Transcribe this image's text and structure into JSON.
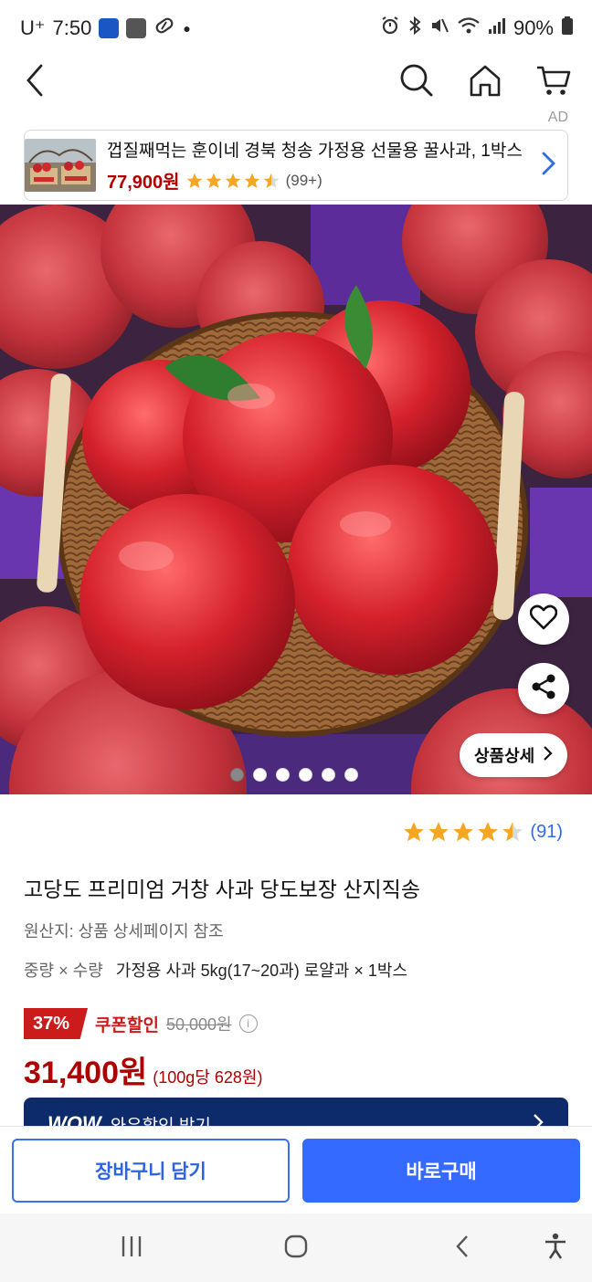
{
  "status_bar": {
    "carrier": "U⁺",
    "time": "7:50",
    "battery": "90%"
  },
  "header": {
    "back": "back-icon",
    "search": "search-icon",
    "home": "home-icon",
    "cart": "cart-icon"
  },
  "ad": {
    "label": "AD",
    "title": "껍질째먹는 훈이네 경북 청송 가정용 선물용 꿀사과, 1박스",
    "price": "77,900원",
    "rating": 4.5,
    "review_count": "(99+)"
  },
  "hero": {
    "detail_label": "상품상세",
    "image_count": 6,
    "active_index": 0
  },
  "product": {
    "rating": 4.5,
    "review_count": "(91)",
    "title": "고당도 프리미엄 거창 사과 당도보장 산지직송",
    "origin": "원산지: 상품 상세페이지 참조",
    "option_label": "중량 × 수량",
    "option_value": "가정용 사과 5kg(17~20과) 로얄과 × 1박스",
    "discount_pct": "37%",
    "coupon_label": "쿠폰할인",
    "original_price": "50,000원",
    "price": "31,400원",
    "unit_price": "(100g당 628원)",
    "wow_logo": "WOW",
    "wow_text": "와우할인 받기"
  },
  "actions": {
    "cart_label": "장바구니 담기",
    "buy_label": "바로구매"
  },
  "colors": {
    "accent": "#346aff",
    "price": "#ae0000",
    "star": "#f5a623"
  }
}
